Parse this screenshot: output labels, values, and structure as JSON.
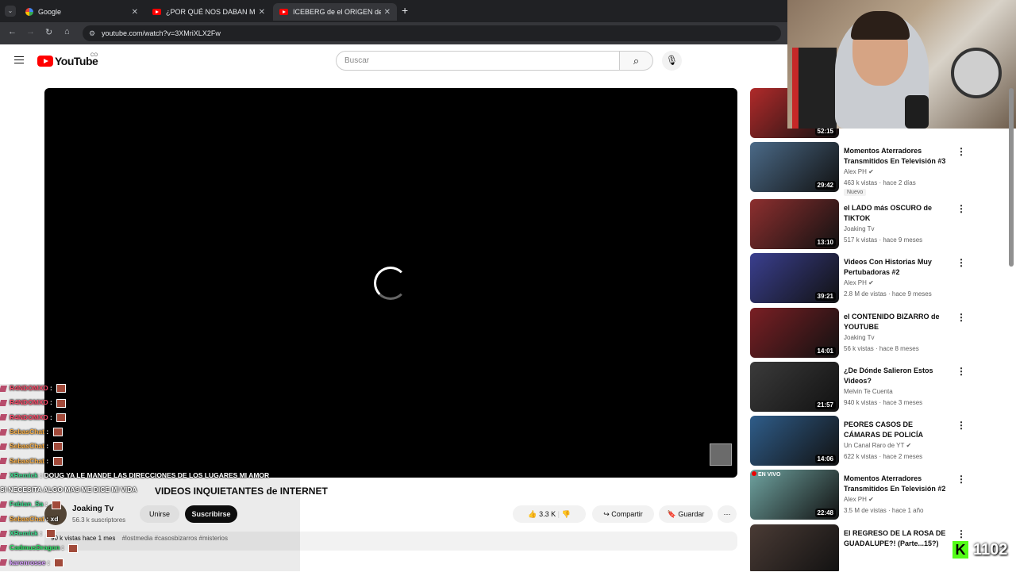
{
  "browser": {
    "tabs": [
      {
        "label": "Google",
        "active": false
      },
      {
        "label": "¿POR QUÉ NOS DABAN MIEDO",
        "active": false
      },
      {
        "label": "ICEBERG de el ORIGEN de VID",
        "active": true
      }
    ],
    "new_tab_label": "+",
    "url": "youtube.com/watch?v=3XMriXLX2Fw"
  },
  "youtube": {
    "logo_text": "YouTube",
    "logo_sup": "CO",
    "search_placeholder": "Buscar"
  },
  "video": {
    "title": "VIDEOS INQUIETANTES de INTERNET",
    "channel": "Joaking Tv",
    "subscribers": "56.3 k suscriptores",
    "join_label": "Unirse",
    "subscribe_label": "Suscribirse",
    "likes": "3.3 K",
    "share_label": "Compartir",
    "save_label": "Guardar",
    "views_date": "90 k vistas  hace 1 mes",
    "hashtags": "#lostmedia #casosbizarros #misterios"
  },
  "recommended": [
    {
      "title": "",
      "channel": "",
      "meta": "",
      "duration": "52:15",
      "thumb_color": "#b02a2a"
    },
    {
      "title": "Momentos Aterradores Transmitidos En Televisión #3",
      "channel": "Alex PH",
      "verified": true,
      "meta": "463 k vistas · hace 2 días",
      "badge": "Nuevo",
      "duration": "29:42",
      "thumb_color": "#4b6a88"
    },
    {
      "title": "el LADO más OSCURO de TIKTOK",
      "channel": "Joaking Tv",
      "meta": "517 k vistas · hace 9 meses",
      "duration": "13:10",
      "thumb_color": "#8d2f2f"
    },
    {
      "title": "Videos Con Historias Muy Pertubadoras #2",
      "channel": "Alex PH",
      "verified": true,
      "meta": "2.8 M de vistas · hace 9 meses",
      "duration": "39:21",
      "thumb_color": "#3a3f8f"
    },
    {
      "title": "el CONTENIDO BIZARRO de YOUTUBE",
      "channel": "Joaking Tv",
      "meta": "56 k vistas · hace 8 meses",
      "duration": "14:01",
      "thumb_color": "#7a1f24"
    },
    {
      "title": "¿De Dónde Salieron Estos Videos?",
      "channel": "Melvin Te Cuenta",
      "meta": "940 k vistas · hace 3 meses",
      "duration": "21:57",
      "thumb_color": "#3b3b3b"
    },
    {
      "title": "PEORES CASOS DE CÁMARAS DE POLICÍA",
      "channel": "Un Canal Raro de YT",
      "verified": true,
      "meta": "622 k vistas · hace 2 meses",
      "duration": "14:06",
      "thumb_color": "#2f5d8a"
    },
    {
      "title": "Momentos Aterradores Transmitidos En Televisión #2",
      "channel": "Alex PH",
      "verified": true,
      "meta": "3.5 M de vistas · hace 1 año",
      "duration": "22:48",
      "thumb_color": "#6fa3a0",
      "live_label": "EN VIVO"
    },
    {
      "title": "El REGRESO DE LA ROSA DE GUADALUPE?! (Parte...15?)",
      "channel": "",
      "meta": "",
      "duration": "",
      "thumb_color": "#4a3b35"
    }
  ],
  "chat": [
    {
      "user": "R4NDOMXD",
      "color": "#ff4f6d",
      "msg": ""
    },
    {
      "user": "R4NDOMXD",
      "color": "#ff4f6d",
      "msg": ""
    },
    {
      "user": "R4NDOMXD",
      "color": "#ff4f6d",
      "msg": ""
    },
    {
      "user": "SebasChat",
      "color": "#ffb347",
      "msg": ""
    },
    {
      "user": "SebasChat",
      "color": "#ffb347",
      "msg": ""
    },
    {
      "user": "SebasChat",
      "color": "#ffb347",
      "msg": ""
    },
    {
      "user": "XRemick",
      "color": "#3ad88b",
      "msg": "DOUG YA LE MANDE LAS DIRECCIONES DE LOS LUGARES MI AMOR"
    },
    {
      "user": "",
      "color": "#ffffff",
      "msg": "SI NECESITA ALGO MAS ME DICE MI VIDA"
    },
    {
      "user": "Fabian_Sa",
      "color": "#3ad88b",
      "msg": ""
    },
    {
      "user": "SebasChat",
      "color": "#ffb347",
      "msg": "xd"
    },
    {
      "user": "XRemick",
      "color": "#3ad88b",
      "msg": ""
    },
    {
      "user": "CadmusDragon",
      "color": "#2ee86a",
      "msg": ""
    },
    {
      "user": "karenrosse",
      "color": "#d9a0ff",
      "msg": ""
    }
  ],
  "kick": {
    "viewers": "1102",
    "icon_letter": "K",
    "accent": "#53fc18"
  },
  "colors": {
    "yt_red": "#ff0000",
    "chrome_dark": "#202124"
  }
}
